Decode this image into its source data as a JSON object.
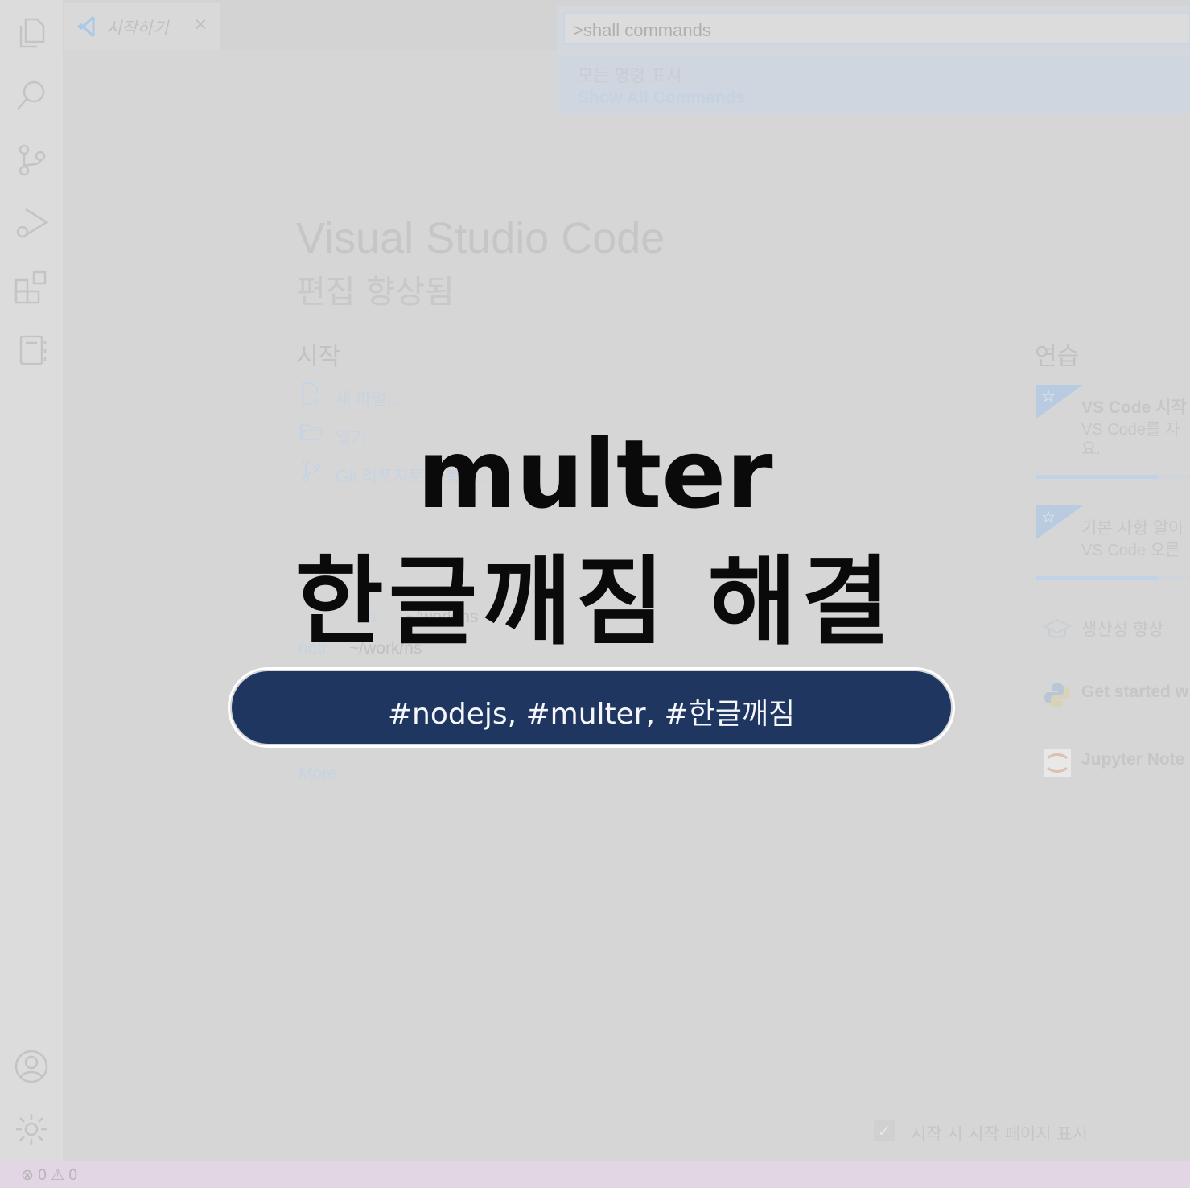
{
  "tab": {
    "label": "시작하기",
    "close": "×"
  },
  "palette": {
    "input_value": ">shall commands",
    "item_label": "모든 명령 표시",
    "item_sub": "Show All Commands"
  },
  "welcome": {
    "title": "Visual Studio Code",
    "subtitle": "편집 향상됨",
    "start_heading": "시작",
    "start_items": [
      "새 파일...",
      "열기...",
      "Git 리포지토리 복제..."
    ],
    "recent": [
      {
        "name": "sh",
        "path": "~/work/ns"
      },
      {
        "name": "noti",
        "path": "~/work/ns"
      }
    ],
    "more": "More...",
    "practice_heading": "연습",
    "cards": [
      {
        "title": "VS Code 시작",
        "desc1": "VS Code를 자",
        "desc2": "요.",
        "progress": 0.75
      },
      {
        "title": "기본 사항 알아",
        "desc1": "VS Code 오른",
        "desc2": "",
        "progress": 0.75
      }
    ],
    "walkthroughs": [
      "생산성 향상",
      "Get started w",
      "Jupyter Note"
    ],
    "startup_label": "시작 시 시작 페이지 표시"
  },
  "status": {
    "errors": "0",
    "warnings": "0"
  },
  "overlay": {
    "heading1": "multer",
    "heading2": "한글깨짐 해결",
    "tags": "#nodejs, #multer, #한글깨짐"
  }
}
